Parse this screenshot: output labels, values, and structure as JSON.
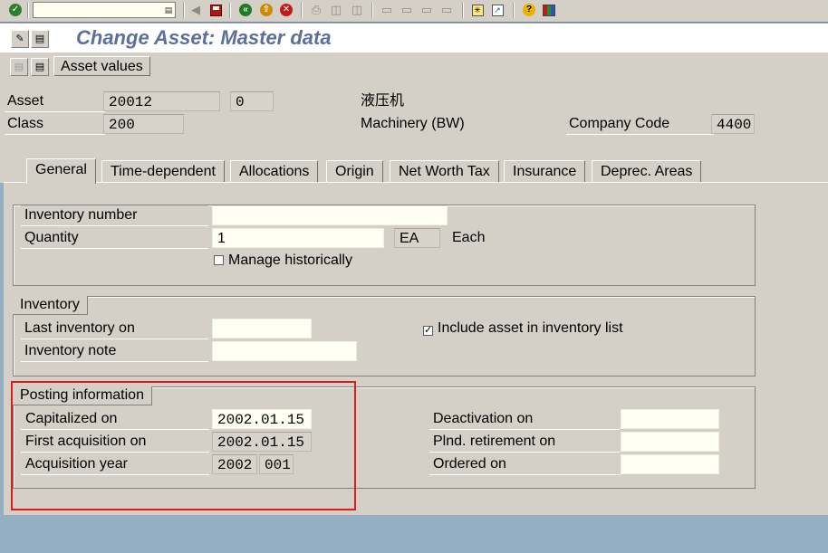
{
  "toolbar": {
    "command_value": "",
    "icons": [
      "enter-icon",
      "command-history-icon",
      "back-nav-icon",
      "save-icon",
      "back-icon",
      "exit-icon",
      "cancel-icon",
      "print-icon",
      "find-icon",
      "find-next-icon",
      "first-page-icon",
      "previous-page-icon",
      "next-page-icon",
      "last-page-icon",
      "new-session-icon",
      "shortcut-icon",
      "help-icon",
      "customize-layout-icon"
    ]
  },
  "title": "Change Asset:  Master data",
  "app_toolbar": {
    "asset_values_label": "Asset values"
  },
  "header": {
    "asset_label": "Asset",
    "asset_value": "20012",
    "subnumber_value": "0",
    "asset_description": "液压机",
    "class_label": "Class",
    "class_value": "200",
    "class_description": "Machinery (BW)",
    "company_code_label": "Company Code",
    "company_code_value": "4400"
  },
  "tabs": [
    {
      "label": "General",
      "active": true
    },
    {
      "label": "Time-dependent",
      "active": false
    },
    {
      "label": "Allocations",
      "active": false
    },
    {
      "label": "Origin",
      "active": false
    },
    {
      "label": "Net Worth Tax",
      "active": false
    },
    {
      "label": "Insurance",
      "active": false
    },
    {
      "label": "Deprec. Areas",
      "active": false
    }
  ],
  "general_group": {
    "inventory_number_label": "Inventory number",
    "inventory_number_value": "",
    "quantity_label": "Quantity",
    "quantity_value": "1",
    "unit_value": "EA",
    "unit_text": "Each",
    "manage_historically_label": "Manage historically",
    "manage_historically_checked": false
  },
  "inventory_group": {
    "title": "Inventory",
    "last_inventory_label": "Last inventory on",
    "last_inventory_value": "",
    "inventory_note_label": "Inventory note",
    "inventory_note_value": "",
    "include_in_list_label": "Include asset in inventory list",
    "include_in_list_checked": true
  },
  "posting_group": {
    "title": "Posting information",
    "capitalized_label": "Capitalized on",
    "capitalized_value": "2002.01.15",
    "first_acquisition_label": "First acquisition on",
    "first_acquisition_value": "2002.01.15",
    "acquisition_year_label": "Acquisition year",
    "acquisition_year_value": "2002",
    "acquisition_period_value": "001",
    "deactivation_label": "Deactivation on",
    "deactivation_value": "",
    "planned_retirement_label": "Plnd. retirement on",
    "planned_retirement_value": "",
    "ordered_label": "Ordered on",
    "ordered_value": ""
  },
  "colors": {
    "title_text": "#5d6f9c",
    "highlight_border": "#e4191b",
    "background": "#94aec4",
    "panel": "#d4d0c8"
  }
}
